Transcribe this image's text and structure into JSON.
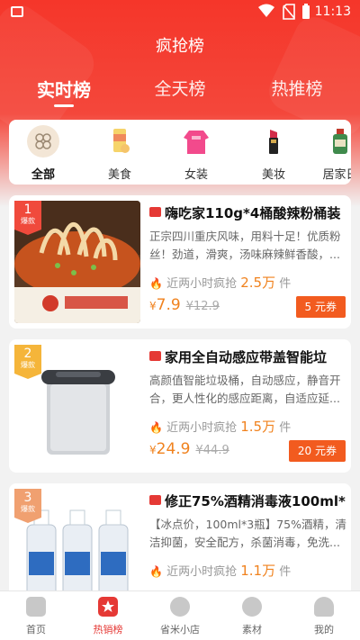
{
  "status_bar": {
    "time": "11:13"
  },
  "header": {
    "title": "疯抢榜"
  },
  "main_tabs": [
    {
      "label": "实时榜",
      "active": true
    },
    {
      "label": "全天榜",
      "active": false
    },
    {
      "label": "热推榜",
      "active": false
    }
  ],
  "categories": [
    {
      "label": "全部",
      "active": true
    },
    {
      "label": "美食"
    },
    {
      "label": "女装"
    },
    {
      "label": "美妆"
    },
    {
      "label": "居家日"
    }
  ],
  "products": [
    {
      "rank": "1",
      "rank_tag": "爆款",
      "title": "嗨吃家110g*4桶酸辣粉桶装",
      "desc": "正宗四川重庆风味，用料十足！优质粉丝！劲道，滑爽，汤味麻辣鲜香酸，...",
      "sold_prefix": "近两小时疯抢",
      "sold_count": "2.5万",
      "sold_suffix": "件",
      "currency": "¥",
      "price": "7.9",
      "old_price": "¥12.9",
      "coupon": "5 元券"
    },
    {
      "rank": "2",
      "rank_tag": "爆款",
      "title": "家用全自动感应带盖智能垃",
      "desc": "高颜值智能垃圾桶，自动感应，静音开合，更人性化的感应距离，自适应延...",
      "sold_prefix": "近两小时疯抢",
      "sold_count": "1.5万",
      "sold_suffix": "件",
      "currency": "¥",
      "price": "24.9",
      "old_price": "¥44.9",
      "coupon": "20 元券"
    },
    {
      "rank": "3",
      "rank_tag": "爆款",
      "title": "修正75%酒精消毒液100ml*3",
      "desc": "【冰点价，100ml*3瓶】75%酒精，清洁抑菌，安全配方，杀菌消毒，免洗...",
      "sold_prefix": "近两小时疯抢",
      "sold_count": "1.1万",
      "sold_suffix": "件",
      "currency": "",
      "price": "",
      "old_price": "",
      "coupon": ""
    }
  ],
  "bottom_nav": [
    {
      "label": "首页"
    },
    {
      "label": "热销榜",
      "active": true
    },
    {
      "label": "省米小店"
    },
    {
      "label": "素材"
    },
    {
      "label": "我的"
    }
  ],
  "colors": {
    "accent": "#f5362a",
    "price": "#f0821e",
    "coupon": "#f25b1f"
  }
}
